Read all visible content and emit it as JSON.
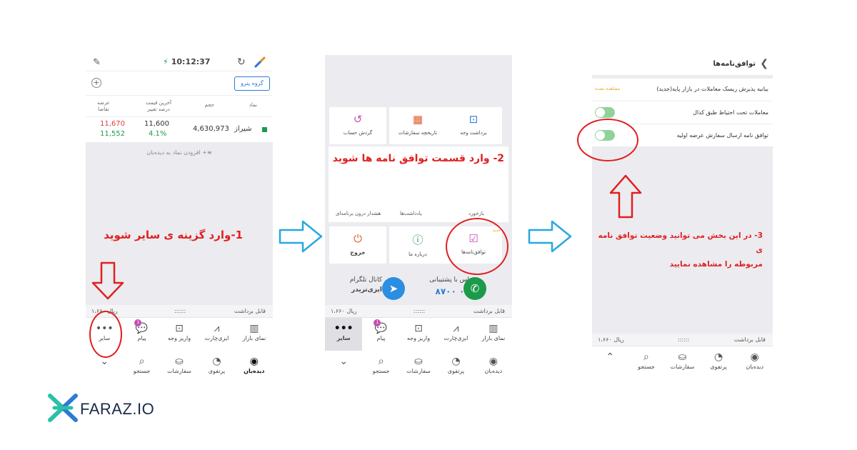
{
  "phone1": {
    "time": "10:12:37",
    "group_button": "گروه پنرو",
    "columns": {
      "symbol": "نماد",
      "volume": "حجم",
      "last_price": "آخرین قیمت",
      "change_pct": "درصد تغییر",
      "ask": "عرضه",
      "bid": "تقاضا"
    },
    "row": {
      "symbol": "شیراز",
      "volume": "4,630,973",
      "last_price": "11,600",
      "change": "4.1%",
      "ask": "11,670",
      "bid": "11,552"
    },
    "add_to_watch": "افزودن نماد به دیده‌بان",
    "annotation": "1-وارد گزینه ی سایر شوید",
    "balance_label": "قابل برداشت",
    "balance_mask": "::::::",
    "balance_value": "۱،۶۶۰ ریال",
    "nav_top": [
      "نمای بازار",
      "ایزی‌چارت",
      "واریز وجه",
      "پیام",
      "سایر"
    ],
    "nav_bottom": [
      "دیده‌بان",
      "پرتفوی",
      "سفارشات",
      "جستجو",
      ""
    ],
    "badge": "1"
  },
  "phone2": {
    "tiles_row1": [
      "برداشت وجه",
      "تاریخچه سفارشات",
      "گردش حساب"
    ],
    "annotation": "2- وارد قسمت توافق نامه ها شوید",
    "tiles_row2": [
      "یادداشت‌ها",
      "هشدار درون برنامه‌ای"
    ],
    "tiles_row2_partial": "بازخورد",
    "tiles_row3": [
      "توافق‌نامه‌ها",
      "درباره ما",
      "خروج"
    ],
    "new_label": "جدید",
    "support_label": "تماس با پشتیبانی",
    "support_number": "۰۲۱ ۸۷۰۰",
    "telegram_label": "کانال تلگرام",
    "telegram_name": "ایزی‌تریدر",
    "balance_label": "قابل برداشت",
    "balance_mask": "::::::",
    "balance_value": "۱،۶۶۰ ریال",
    "nav_top": [
      "نمای بازار",
      "ایزی‌چارت",
      "واریز وجه",
      "پیام",
      "سایر"
    ],
    "nav_bottom": [
      "دیده‌بان",
      "پرتفوی",
      "سفارشات",
      "جستجو",
      ""
    ],
    "badge": "1"
  },
  "phone3": {
    "title": "توافق‌نامه‌ها",
    "rows": [
      {
        "label": "بیانیه پذیرش ریسک معاملات در بازار پایه(جدید)",
        "status": "مشاهده نشده"
      },
      {
        "label": "معاملات تحت احتیاط طبق کدال"
      },
      {
        "label": "توافق نامه ارسال سفارش عرضه اولیه"
      }
    ],
    "annotation_line1": "3- در این بخش می توانید وضعیت توافق نامه ی",
    "annotation_line2": "مربوطه را مشاهده نمایید",
    "balance_label": "قابل برداشت",
    "balance_mask": "::::::",
    "balance_value": "۱،۶۶۰ ریال",
    "nav": [
      "دیده‌بان",
      "پرتفوی",
      "سفارشات",
      "جستجو",
      ""
    ]
  },
  "logo": {
    "text": "FARAZ.IO"
  },
  "colors": {
    "annotation": "#e02020",
    "arrow": "#28a8e0",
    "accent": "#2b7bd6",
    "toggle": "#8fd39a"
  }
}
